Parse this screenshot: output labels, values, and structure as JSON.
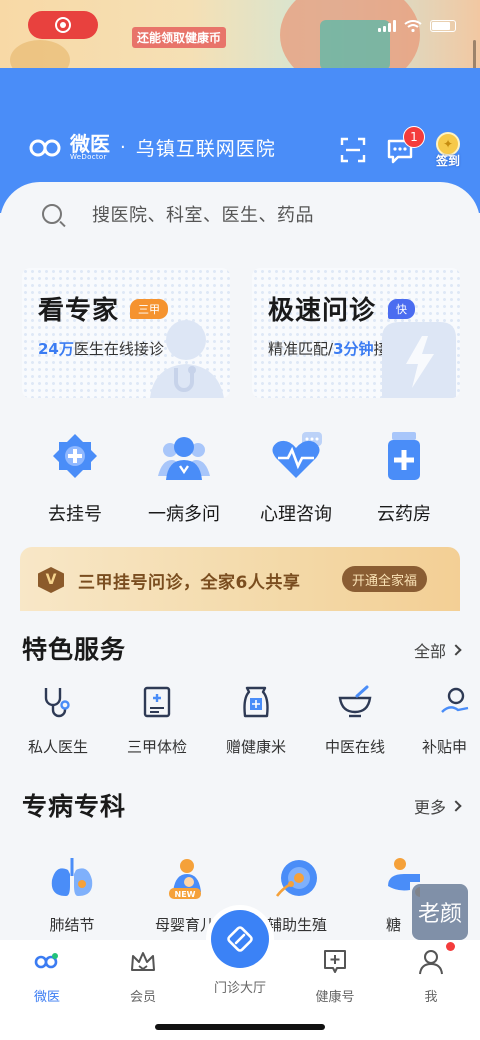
{
  "status_banner": {
    "tag": "还能领取健康币"
  },
  "header": {
    "brand": "微医",
    "brand_sub": "WeDoctor",
    "separator": "·",
    "hospital": "乌镇互联网医院",
    "message_badge": "1",
    "signin_label": "签到"
  },
  "search": {
    "placeholder": "搜医院、科室、医生、药品"
  },
  "cards": [
    {
      "title": "看专家",
      "badge": "三甲",
      "sub_highlight": "24万",
      "sub_text": "医生在线接诊"
    },
    {
      "title": "极速问诊",
      "badge": "快",
      "sub_pre": "精准匹配/",
      "sub_highlight": "3分钟",
      "sub_text": "接诊"
    }
  ],
  "quick_entries": [
    {
      "label": "去挂号",
      "icon": "registration-icon"
    },
    {
      "label": "一病多问",
      "icon": "multi-doctor-icon"
    },
    {
      "label": "心理咨询",
      "icon": "heart-pulse-icon"
    },
    {
      "label": "云药房",
      "icon": "medicine-bottle-icon"
    }
  ],
  "promo": {
    "badge": "V",
    "text": "三甲挂号问诊，全家6人共享",
    "button": "开通全家福"
  },
  "featured": {
    "title": "特色服务",
    "more": "全部",
    "items": [
      {
        "label": "私人医生",
        "icon": "stethoscope-icon"
      },
      {
        "label": "三甲体检",
        "icon": "checkup-report-icon"
      },
      {
        "label": "赠健康米",
        "icon": "rice-bag-icon"
      },
      {
        "label": "中医在线",
        "icon": "mortar-icon"
      },
      {
        "label": "补贴申",
        "icon": "subsidy-icon"
      }
    ]
  },
  "specialty": {
    "title": "专病专科",
    "more": "更多",
    "items": [
      {
        "label": "肺结节",
        "icon": "lungs-icon"
      },
      {
        "label": "母婴育儿",
        "icon": "mother-baby-icon",
        "tag": "NEW"
      },
      {
        "label": "辅助生殖",
        "icon": "reproduction-icon"
      },
      {
        "label": "糖",
        "icon": "diabetes-icon"
      }
    ]
  },
  "seal_text": "老颜",
  "tabbar": [
    {
      "label": "微医",
      "icon": "wedoctor-tab-icon",
      "active": true
    },
    {
      "label": "会员",
      "icon": "crown-icon"
    },
    {
      "label": "门诊大厅",
      "icon": "clinic-hall-icon"
    },
    {
      "label": "健康号",
      "icon": "health-account-icon"
    },
    {
      "label": "我",
      "icon": "profile-icon"
    }
  ],
  "colors": {
    "primary": "#4a8df8",
    "accent_blue": "#3b7cf2",
    "badge_orange": "#f5932f",
    "badge_red": "#f43c3c",
    "promo_brown": "#7a4d1f"
  }
}
